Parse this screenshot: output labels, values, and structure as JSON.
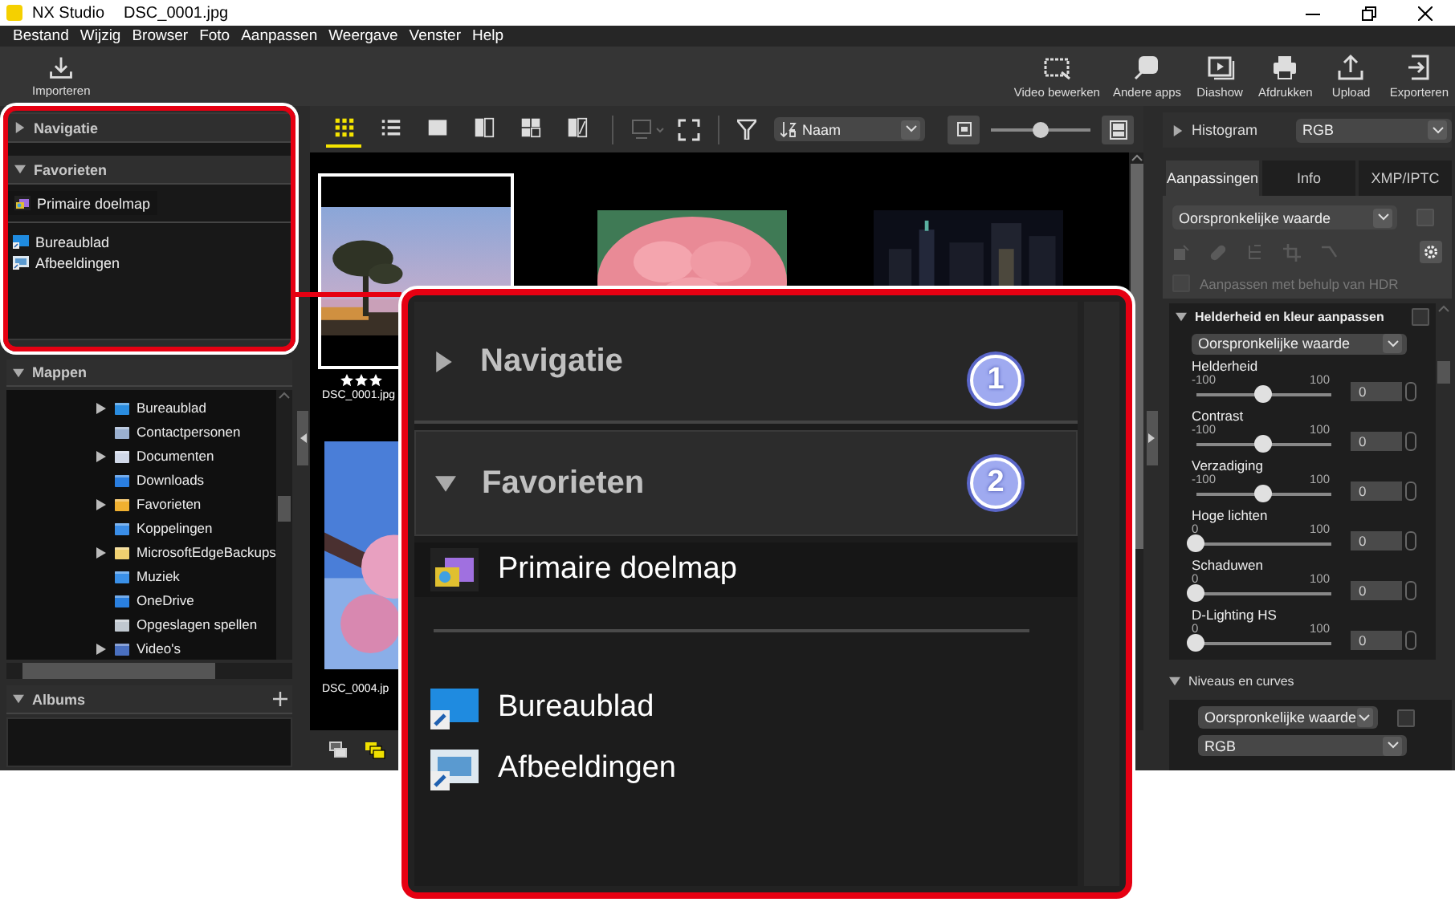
{
  "window": {
    "app": "NX Studio",
    "file": "DSC_0001.jpg"
  },
  "menu": [
    "Bestand",
    "Wijzig",
    "Browser",
    "Foto",
    "Aanpassen",
    "Weergave",
    "Venster",
    "Help"
  ],
  "toolbar": {
    "import": "Importeren",
    "actions": [
      "Video bewerken",
      "Andere apps",
      "Diashow",
      "Afdrukken",
      "Upload",
      "Exporteren"
    ]
  },
  "left": {
    "navigation": {
      "title": "Navigatie",
      "expanded": false
    },
    "favorites": {
      "title": "Favorieten",
      "expanded": true,
      "primary": "Primaire doelmap",
      "items": [
        "Bureaublad",
        "Afbeeldingen"
      ]
    },
    "folders": {
      "title": "Mappen",
      "expanded": true,
      "items": [
        {
          "label": "Bureaublad",
          "expandable": true
        },
        {
          "label": "Contactpersonen",
          "expandable": false
        },
        {
          "label": "Documenten",
          "expandable": true
        },
        {
          "label": "Downloads",
          "expandable": false
        },
        {
          "label": "Favorieten",
          "expandable": true
        },
        {
          "label": "Koppelingen",
          "expandable": false
        },
        {
          "label": "MicrosoftEdgeBackups",
          "expandable": true
        },
        {
          "label": "Muziek",
          "expandable": false
        },
        {
          "label": "OneDrive",
          "expandable": false
        },
        {
          "label": "Opgeslagen spellen",
          "expandable": false
        },
        {
          "label": "Video's",
          "expandable": true
        }
      ]
    },
    "albums": {
      "title": "Albums",
      "expanded": true
    }
  },
  "browser": {
    "view_buttons": [
      {
        "selected": true
      },
      {
        "selected": false
      },
      {
        "selected": false
      },
      {
        "selected": false
      },
      {
        "selected": false
      },
      {
        "selected": false
      }
    ],
    "sort": "Naam",
    "thumb_size": {
      "level": 0.5
    },
    "rows": [
      [
        {
          "selected": true,
          "stars": 3,
          "name": "DSC_0001.jpg"
        },
        {
          "selected": false
        },
        {
          "selected": false
        }
      ],
      [
        {
          "selected": false,
          "name": "DSC_0004.jp"
        }
      ]
    ]
  },
  "adjust": {
    "histogram": {
      "title": "Histogram",
      "expanded": false,
      "channel": "RGB"
    },
    "tabs": [
      {
        "label": "Aanpassingen",
        "selected": true
      },
      {
        "label": "Info",
        "selected": false
      },
      {
        "label": "XMP/IPTC",
        "selected": false
      }
    ],
    "preset": "Oorspronkelijke waarde",
    "preset_checked": false,
    "hdr": {
      "label": "Aanpassen met behulp van HDR",
      "checked": false
    },
    "sections": [
      {
        "title": "Helderheid en kleur aanpassen",
        "expanded": true,
        "checked": false,
        "preset": "Oorspronkelijke waarde",
        "sliders": [
          {
            "name": "Helderheid",
            "min": "-100",
            "max": "100",
            "level": 0.5,
            "value": "0"
          },
          {
            "name": "Contrast",
            "min": "-100",
            "max": "100",
            "level": 0.5,
            "value": "0"
          },
          {
            "name": "Verzadiging",
            "min": "-100",
            "max": "100",
            "level": 0.5,
            "value": "0"
          },
          {
            "name": "Hoge lichten",
            "min": "0",
            "max": "100",
            "level": 0,
            "value": "0"
          },
          {
            "name": "Schaduwen",
            "min": "0",
            "max": "100",
            "level": 0,
            "value": "0"
          },
          {
            "name": "D-Lighting HS",
            "min": "0",
            "max": "100",
            "level": 0,
            "value": "0"
          }
        ]
      },
      {
        "title": "Niveaus en curves",
        "expanded": true,
        "checked": false,
        "preset": "Oorspronkelijke waarde",
        "channel": "RGB"
      }
    ]
  },
  "callout": {
    "navigation": {
      "title": "Navigatie",
      "expanded": false
    },
    "favorites": {
      "title": "Favorieten",
      "expanded": true
    },
    "primary": "Primaire doelmap",
    "items": [
      "Bureaublad",
      "Afbeeldingen"
    ],
    "markers": [
      "1",
      "2"
    ]
  }
}
